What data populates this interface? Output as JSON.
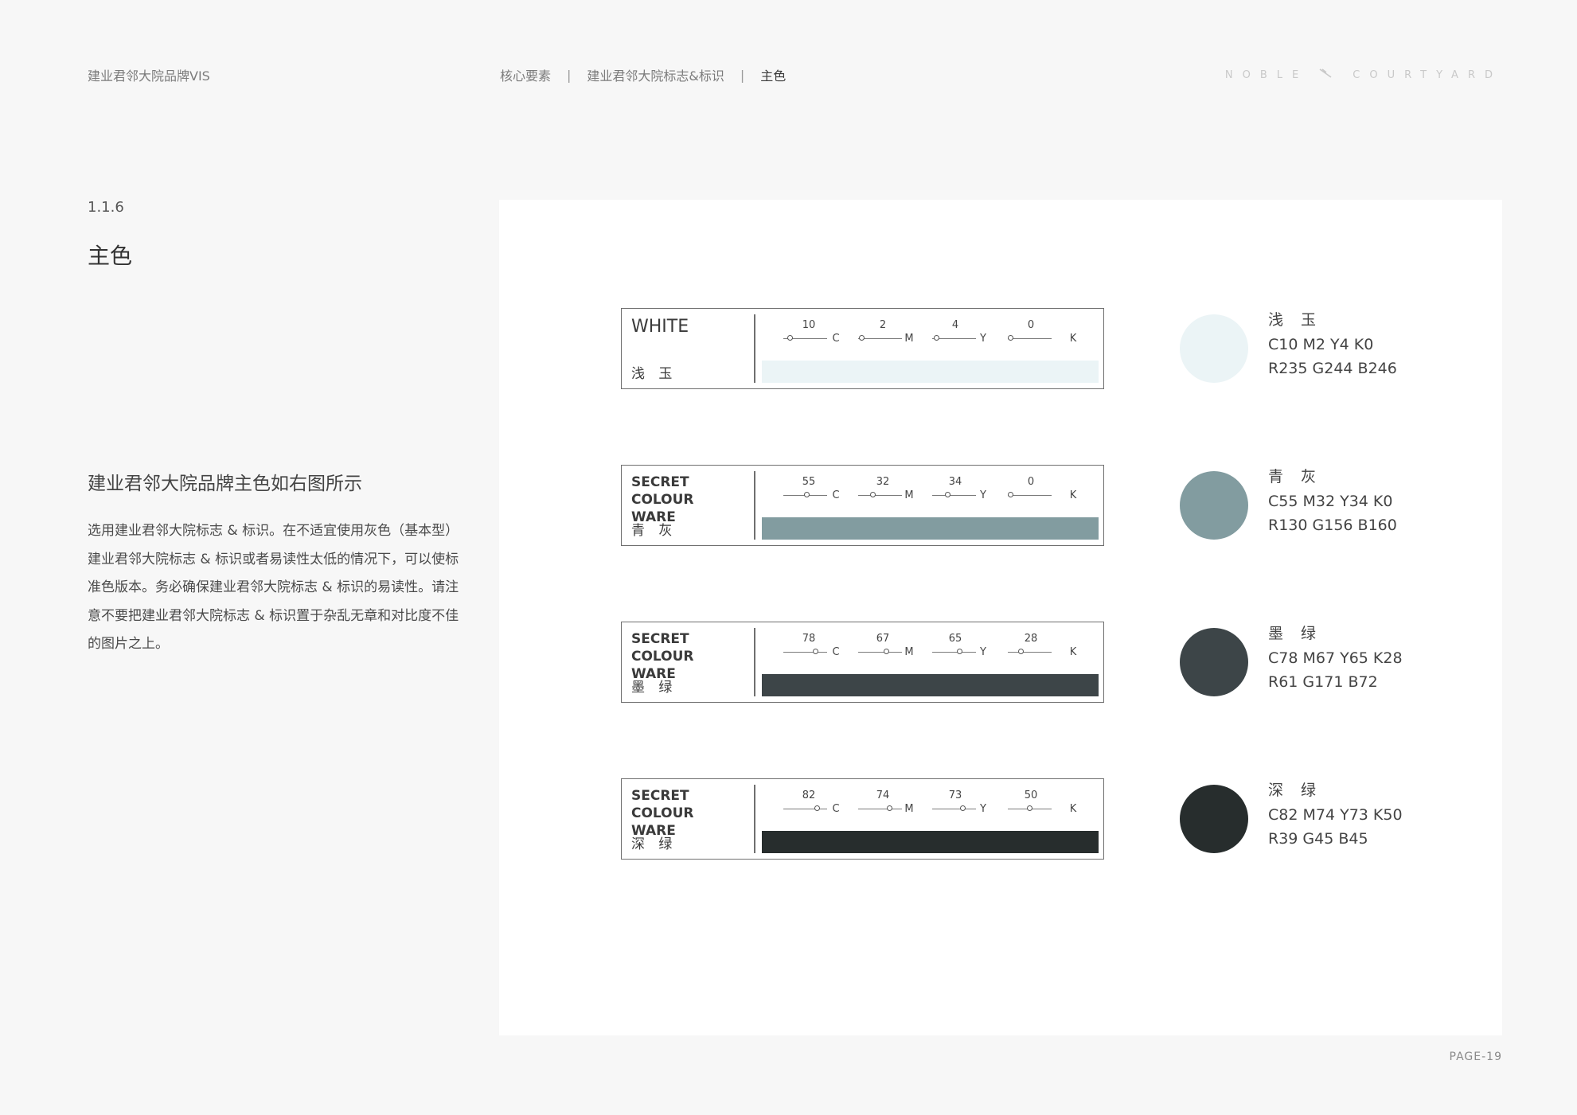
{
  "header": {
    "brand": "建业君邻大院品牌VIS",
    "breadcrumb": [
      "核心要素",
      "建业君邻大院标志&标识",
      "主色"
    ],
    "separator": "|",
    "logo_left": "NOBLE",
    "logo_right": "COURTYARD",
    "logo_icon": "feather-icon"
  },
  "section": {
    "number": "1.1.6",
    "title": "主色",
    "subheading": "建业君邻大院品牌主色如右图所示",
    "body": "选用建业君邻大院标志 & 标识。在不适宜使用灰色（基本型）建业君邻大院标志 & 标识或者易读性太低的情况下，可以使标准色版本。务必确保建业君邻大院标志 & 标识的易读性。请注意不要把建业君邻大院标志 & 标识置于杂乱无章和对比度不佳的图片之上。"
  },
  "colors": [
    {
      "name_lines": [
        "WHITE"
      ],
      "cn_name": "浅 玉",
      "cmyk": {
        "C": 10,
        "M": 2,
        "Y": 4,
        "K": 0
      },
      "cmyk_text": "C10 M2 Y4 K0",
      "rgb_text": "R235 G244 B246",
      "hex": "#ebf4f6"
    },
    {
      "name_lines": [
        "SECRET COLOUR",
        "WARE"
      ],
      "cn_name": "青 灰",
      "cmyk": {
        "C": 55,
        "M": 32,
        "Y": 34,
        "K": 0
      },
      "cmyk_text": "C55 M32 Y34 K0",
      "rgb_text": "R130 G156 B160",
      "hex": "#829ca0"
    },
    {
      "name_lines": [
        "SECRET COLOUR",
        "WARE"
      ],
      "cn_name": "墨 绿",
      "cmyk": {
        "C": 78,
        "M": 67,
        "Y": 65,
        "K": 28
      },
      "cmyk_text": "C78 M67 Y65 K28",
      "rgb_text": "R61 G171 B72",
      "hex": "#3d4548"
    },
    {
      "name_lines": [
        "SECRET COLOUR",
        "WARE"
      ],
      "cn_name": "深 绿",
      "cmyk": {
        "C": 82,
        "M": 74,
        "Y": 73,
        "K": 50
      },
      "cmyk_text": "C82 M74 Y73 K50",
      "rgb_text": "R39 G45 B45",
      "hex": "#272d2d"
    }
  ],
  "channel_letters": [
    "C",
    "M",
    "Y",
    "K"
  ],
  "footer": {
    "page": "PAGE-19"
  }
}
